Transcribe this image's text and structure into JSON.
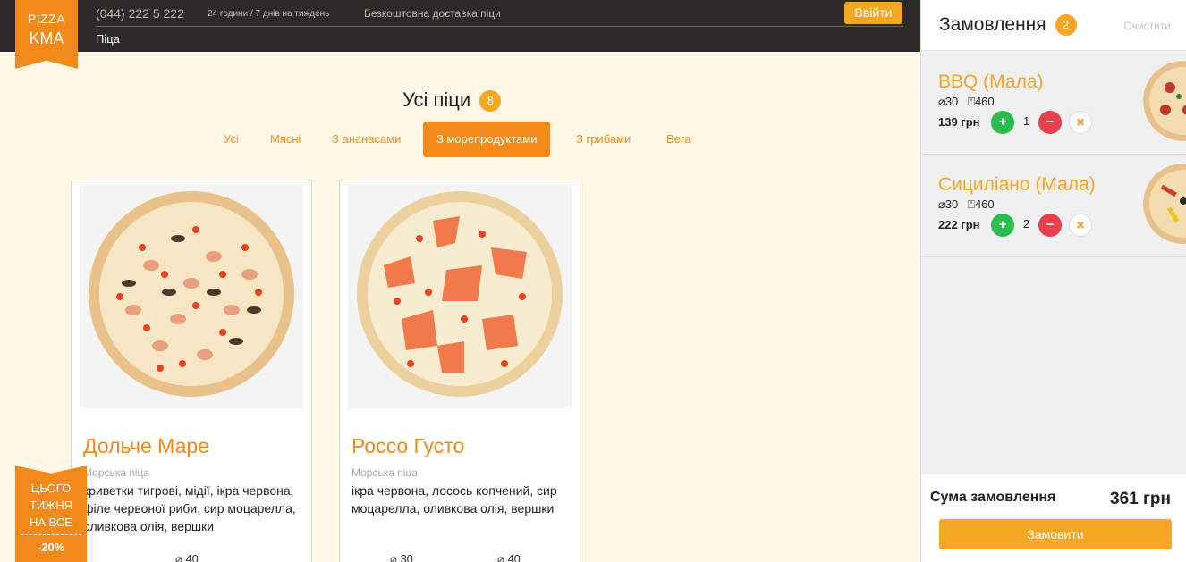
{
  "header": {
    "logo_line1": "PIZZA",
    "logo_line2": "KMA",
    "phone": "(044) 222 5 222",
    "hours": "24 години / 7 днів на тиждень",
    "delivery": "Безкоштовна доставка піци",
    "nav_pizza": "Піца",
    "login": "Ввійти"
  },
  "main": {
    "title": "Усі піци",
    "count": "8",
    "filters": [
      {
        "label": "Усі"
      },
      {
        "label": "Мясні"
      },
      {
        "label": "З ананасами"
      },
      {
        "label": "З морепродуктами"
      },
      {
        "label": "З грибами"
      },
      {
        "label": "Вега"
      }
    ],
    "cards": [
      {
        "name": "Дольче Маре",
        "type": "Морська піца",
        "desc": "криветки тигрові, мідії, ікра червона, філе червоної риби, сир моцарелла, оливкова олія, вершки",
        "sizes": [
          "40"
        ]
      },
      {
        "name": "Россо Густо",
        "type": "Морська піца",
        "desc": "ікра червона, лосось копчений, сир моцарелла, оливкова олія, вершки",
        "sizes": [
          "30",
          "40"
        ]
      }
    ],
    "promo": {
      "line1": "ЦЬОГО",
      "line2": "ТИЖНЯ",
      "line3": "НА ВСЕ",
      "discount": "-20%"
    }
  },
  "cart": {
    "title": "Замовлення",
    "count": "2",
    "clear": "Очистити",
    "items": [
      {
        "name": "BBQ (Мала)",
        "diameter": "30",
        "weight": "460",
        "price": "139 грн",
        "qty": "1"
      },
      {
        "name": "Сициліано (Мала)",
        "diameter": "30",
        "weight": "460",
        "price": "222 грн",
        "qty": "2"
      }
    ],
    "sum_label": "Сума замовлення",
    "sum_value": "361 грн",
    "order_button": "Замовити"
  },
  "colors": {
    "accent": "#f28a1a",
    "accent_light": "#f5a623",
    "header_bg": "#2b2a27",
    "page_bg": "#fff8e6",
    "plus": "#2bbc4f",
    "minus": "#e8414b"
  }
}
